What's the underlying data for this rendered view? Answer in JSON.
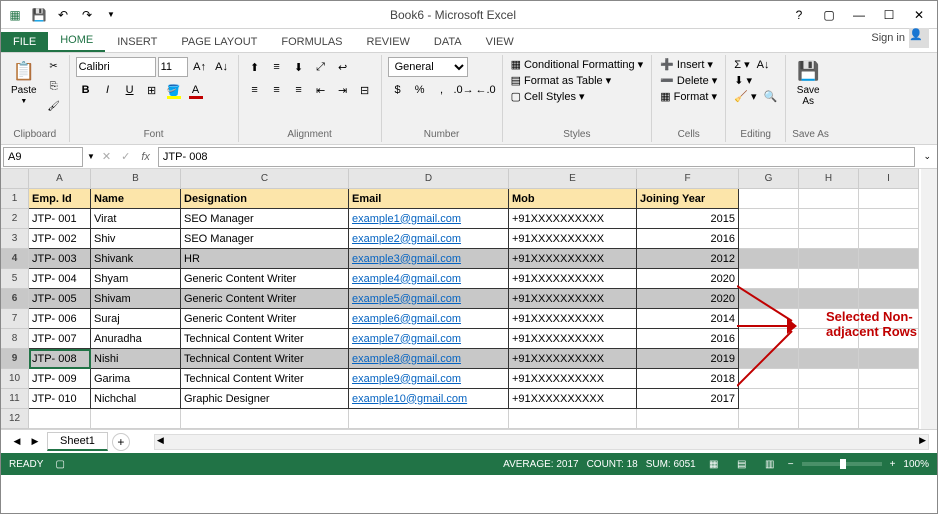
{
  "window": {
    "title": "Book6 - Microsoft Excel",
    "signin": "Sign in",
    "help_icon": "?"
  },
  "tabs": {
    "file": "FILE",
    "home": "HOME",
    "insert": "INSERT",
    "page_layout": "PAGE LAYOUT",
    "formulas": "FORMULAS",
    "review": "REVIEW",
    "data": "DATA",
    "view": "VIEW"
  },
  "ribbon": {
    "clipboard": {
      "label": "Clipboard",
      "paste": "Paste"
    },
    "font": {
      "label": "Font",
      "name": "Calibri",
      "size": "11"
    },
    "alignment": {
      "label": "Alignment"
    },
    "number": {
      "label": "Number",
      "format": "General"
    },
    "styles": {
      "label": "Styles",
      "conditional": "Conditional Formatting",
      "table": "Format as Table",
      "cell": "Cell Styles"
    },
    "cells": {
      "label": "Cells",
      "insert": "Insert",
      "delete": "Delete",
      "format": "Format"
    },
    "editing": {
      "label": "Editing"
    },
    "saveas": {
      "label": "Save As",
      "btn": "Save\nAs"
    }
  },
  "namebox": {
    "ref": "A9",
    "formula": "JTP- 008"
  },
  "columns": [
    "A",
    "B",
    "C",
    "D",
    "E",
    "F",
    "G",
    "H",
    "I"
  ],
  "headers": {
    "emp_id": "Emp. Id",
    "name": "Name",
    "designation": "Designation",
    "email": "Email",
    "mob": "Mob",
    "year": "Joining Year"
  },
  "rows": [
    {
      "num": "2",
      "id": "JTP- 001",
      "name": "Virat",
      "desig": "SEO Manager",
      "email": "example1@gmail.com",
      "mob": "+91XXXXXXXXXX",
      "year": "2015",
      "sel": false
    },
    {
      "num": "3",
      "id": "JTP- 002",
      "name": "Shiv",
      "desig": "SEO Manager",
      "email": "example2@gmail.com",
      "mob": "+91XXXXXXXXXX",
      "year": "2016",
      "sel": false
    },
    {
      "num": "4",
      "id": "JTP- 003",
      "name": "Shivank",
      "desig": "HR",
      "email": "example3@gmail.com",
      "mob": "+91XXXXXXXXXX",
      "year": "2012",
      "sel": true
    },
    {
      "num": "5",
      "id": "JTP- 004",
      "name": "Shyam",
      "desig": "Generic Content Writer",
      "email": "example4@gmail.com",
      "mob": "+91XXXXXXXXXX",
      "year": "2020",
      "sel": false
    },
    {
      "num": "6",
      "id": "JTP- 005",
      "name": "Shivam",
      "desig": "Generic Content Writer",
      "email": "example5@gmail.com",
      "mob": "+91XXXXXXXXXX",
      "year": "2020",
      "sel": true
    },
    {
      "num": "7",
      "id": "JTP- 006",
      "name": "Suraj",
      "desig": "Generic Content Writer",
      "email": "example6@gmail.com",
      "mob": "+91XXXXXXXXXX",
      "year": "2014",
      "sel": false
    },
    {
      "num": "8",
      "id": "JTP- 007",
      "name": "Anuradha",
      "desig": "Technical Content Writer",
      "email": "example7@gmail.com",
      "mob": "+91XXXXXXXXXX",
      "year": "2016",
      "sel": false
    },
    {
      "num": "9",
      "id": "JTP- 008",
      "name": "Nishi",
      "desig": "Technical Content Writer",
      "email": "example8@gmail.com",
      "mob": "+91XXXXXXXXXX",
      "year": "2019",
      "sel": true
    },
    {
      "num": "10",
      "id": "JTP- 009",
      "name": "Garima",
      "desig": "Technical Content Writer",
      "email": "example9@gmail.com",
      "mob": "+91XXXXXXXXXX",
      "year": "2018",
      "sel": false
    },
    {
      "num": "11",
      "id": "JTP- 010",
      "name": "Nichchal",
      "desig": "Graphic Designer",
      "email": "example10@gmail.com",
      "mob": "+91XXXXXXXXXX",
      "year": "2017",
      "sel": false
    }
  ],
  "annotation": {
    "line1": "Selected Non-",
    "line2": "adjacent Rows"
  },
  "sheets": {
    "active": "Sheet1"
  },
  "status": {
    "ready": "READY",
    "average": "AVERAGE: 2017",
    "count": "COUNT: 18",
    "sum": "SUM: 6051",
    "zoom": "100%"
  }
}
